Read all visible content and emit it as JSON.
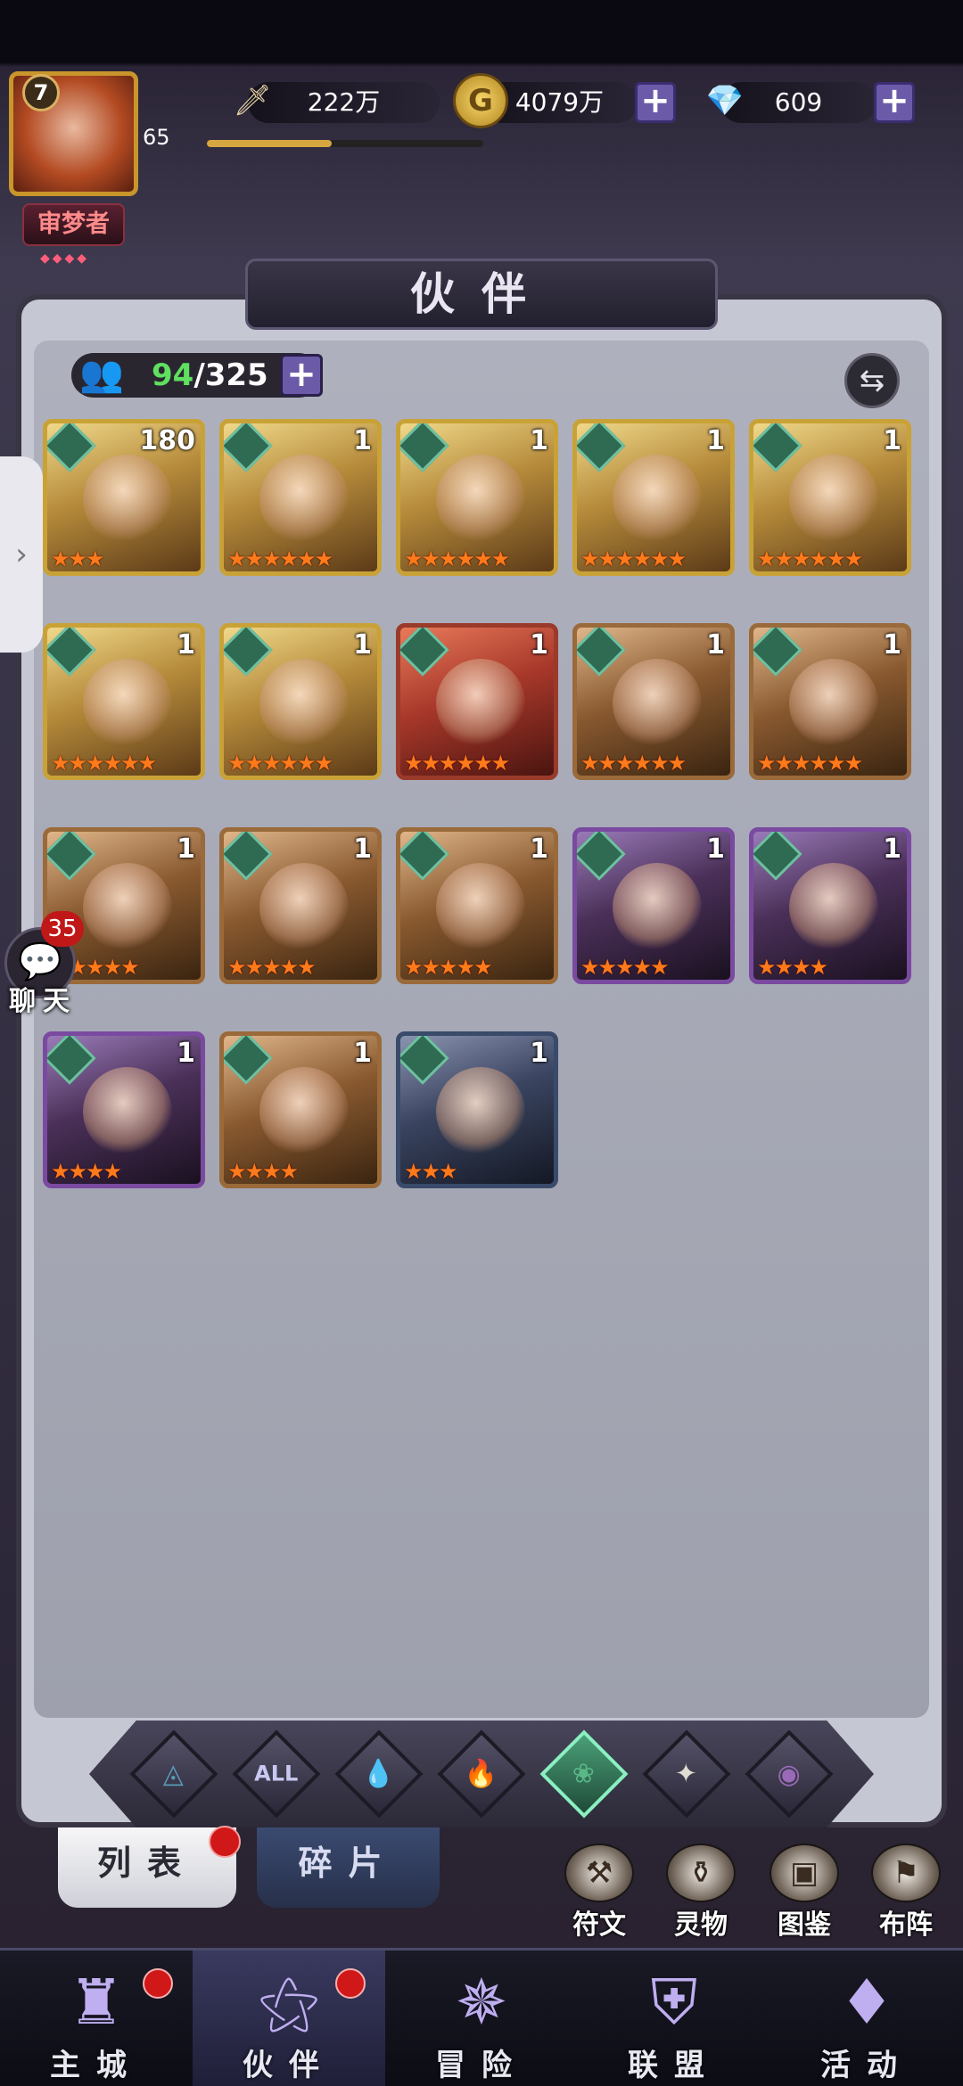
{
  "colors": {
    "panel": "#c5c7d2",
    "accent_purple": "#6a5aa8",
    "star_orange": "#ff7a1a",
    "badge_red": "#d01818",
    "count_green": "#5fe05f"
  },
  "player": {
    "level": "7",
    "power_level": "65",
    "rank": "审梦者",
    "rank_icon": "four-diamonds-icon"
  },
  "resources": {
    "power": {
      "icon": "sword-icon",
      "value": "222万"
    },
    "gold": {
      "icon": "gold-coin-icon",
      "value": "4079万"
    },
    "diamond": {
      "icon": "diamond-icon",
      "value": "609"
    },
    "exp_progress": 0.45
  },
  "page": {
    "title": "伙伴"
  },
  "roster": {
    "count_current": "94",
    "count_total": "/325",
    "icon": "partners-icon"
  },
  "side_tab": {
    "glyph": "›"
  },
  "partners": [
    {
      "lvl": "180",
      "stars": "★★★",
      "tier": "gold"
    },
    {
      "lvl": "1",
      "stars": "★★★★★★",
      "tier": "gold"
    },
    {
      "lvl": "1",
      "stars": "★★★★★★",
      "tier": "gold"
    },
    {
      "lvl": "1",
      "stars": "★★★★★★",
      "tier": "gold"
    },
    {
      "lvl": "1",
      "stars": "★★★★★★",
      "tier": "gold"
    },
    {
      "lvl": "1",
      "stars": "★★★★★★",
      "tier": "gold"
    },
    {
      "lvl": "1",
      "stars": "★★★★★★",
      "tier": "gold"
    },
    {
      "lvl": "1",
      "stars": "★★★★★★",
      "tier": "red"
    },
    {
      "lvl": "1",
      "stars": "★★★★★★",
      "tier": "bronze"
    },
    {
      "lvl": "1",
      "stars": "★★★★★★",
      "tier": "bronze"
    },
    {
      "lvl": "1",
      "stars": "★★★★★",
      "tier": "bronze"
    },
    {
      "lvl": "1",
      "stars": "★★★★★",
      "tier": "bronze"
    },
    {
      "lvl": "1",
      "stars": "★★★★★",
      "tier": "bronze"
    },
    {
      "lvl": "1",
      "stars": "★★★★★",
      "tier": "purple"
    },
    {
      "lvl": "1",
      "stars": "★★★★",
      "tier": "purple"
    },
    {
      "lvl": "1",
      "stars": "★★★★",
      "tier": "purple"
    },
    {
      "lvl": "1",
      "stars": "★★★★",
      "tier": "bronze"
    },
    {
      "lvl": "1",
      "stars": "★★★",
      "tier": "blue"
    }
  ],
  "chat": {
    "unread": "35",
    "label": "聊天",
    "icon": "chat-bubble-icon"
  },
  "filters": [
    {
      "name": "filter-light",
      "glyph": "◬",
      "color": "#5a9ab8"
    },
    {
      "name": "filter-all",
      "glyph": "ALL",
      "color": "#c8c8f0"
    },
    {
      "name": "filter-water",
      "glyph": "💧",
      "color": "#5a8ac8"
    },
    {
      "name": "filter-fire",
      "glyph": "🔥",
      "color": "#c8584a"
    },
    {
      "name": "filter-nature",
      "glyph": "❀",
      "color": "#5ab888"
    },
    {
      "name": "filter-holy",
      "glyph": "✦",
      "color": "#e0dcd0"
    },
    {
      "name": "filter-dark",
      "glyph": "◉",
      "color": "#9a6ab8"
    }
  ],
  "tabs": {
    "list": "列表",
    "fragments": "碎片"
  },
  "quick_buttons": [
    {
      "label": "符文",
      "icon": "rune-icon",
      "glyph": "⚒"
    },
    {
      "label": "灵物",
      "icon": "spirit-item-icon",
      "glyph": "⚱"
    },
    {
      "label": "图鉴",
      "icon": "codex-icon",
      "glyph": "▣"
    },
    {
      "label": "布阵",
      "icon": "formation-icon",
      "glyph": "⚑"
    }
  ],
  "nav": [
    {
      "label": "主城",
      "icon": "castle-icon",
      "glyph": "♜",
      "dot": true
    },
    {
      "label": "伙伴",
      "icon": "wizard-hat-icon",
      "glyph": "⚝",
      "dot": true,
      "active": true
    },
    {
      "label": "冒险",
      "icon": "compass-icon",
      "glyph": "✵",
      "dot": false
    },
    {
      "label": "联盟",
      "icon": "shield-icon",
      "glyph": "⛨",
      "dot": false
    },
    {
      "label": "活动",
      "icon": "cards-icon",
      "glyph": "♦",
      "dot": false
    }
  ]
}
